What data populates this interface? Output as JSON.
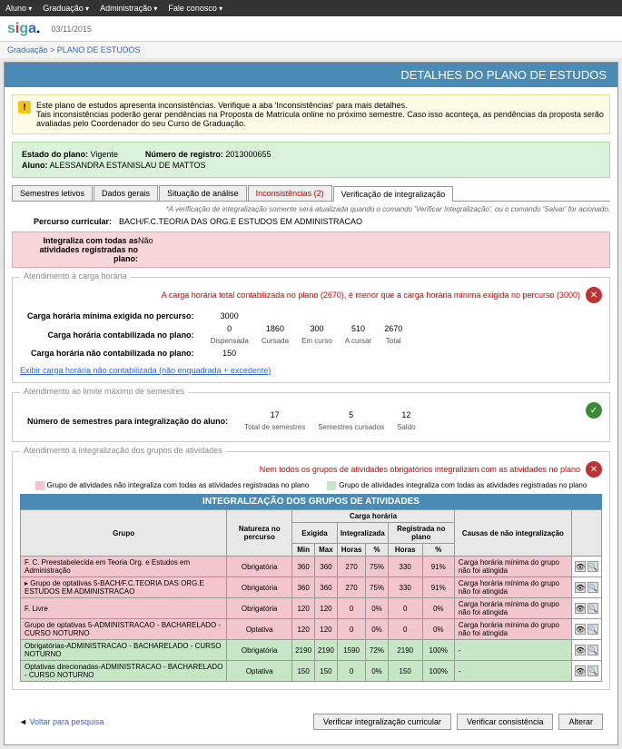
{
  "topbar": [
    "Aluno",
    "Graduação",
    "Administração",
    "Fale conosco"
  ],
  "date": "03/11/2015",
  "breadcrumb": {
    "root": "Graduação",
    "page": "PLANO DE ESTUDOS"
  },
  "title": "DETALHES DO PLANO DE ESTUDOS",
  "warning": {
    "line1": "Este plano de estudos apresenta inconsistências. Verifique a aba 'Inconsistências' para mais detalhes.",
    "line2": "Tais inconsistências poderão gerar pendências na Proposta de Matrícula online no próximo semestre. Caso isso aconteça, as pendências da proposta serão avaliadas pelo Coordenador do seu Curso de Graduação."
  },
  "info": {
    "estado_label": "Estado do plano:",
    "estado": "Vigente",
    "registro_label": "Número de registro:",
    "registro": "2013000655",
    "aluno_label": "Aluno:",
    "aluno": "ALESSANDRA ESTANISLAU DE MATTOS"
  },
  "tabs": {
    "t1": "Semestres letivos",
    "t2": "Dados gerais",
    "t3": "Situação de análise",
    "t4": "Inconsistências (2)",
    "t5": "Verificação de integralização"
  },
  "note": "*A verificação de integralização somente será atualizada quando o comando 'Verificar Integralização', ou o comando 'Salvar' for acionado.",
  "percurso_label": "Percurso curricular:",
  "percurso": "BACH/F.C.TEORIA DAS ORG.E ESTUDOS EM ADMINISTRACAO",
  "integraliza_label": "Integraliza com todas as atividades registradas no plano:",
  "integraliza": "Não",
  "fs1": {
    "legend": "Atendimento à carga horária",
    "err": "A carga horária total contabilizada no plano (2670), é menor que a carga horária mínima exigida no percurso (3000)",
    "r1_label": "Carga horária mínima exigida no percurso:",
    "r1_v": "3000",
    "r2_label": "Carga horária contabilizada no plano:",
    "r2_cols": [
      "0",
      "1860",
      "300",
      "510",
      "2670"
    ],
    "r2_sub": [
      "Dispensada",
      "Cursada",
      "Em curso",
      "A cursar",
      "Total"
    ],
    "r3_label": "Carga horária não contabilizada no plano:",
    "r3_v": "150",
    "link": "Exibir carga horária não contabilizada (não enquadrada + excedente)"
  },
  "fs2": {
    "legend": "Atendimento ao limite máximo de semestres",
    "r_label": "Número de semestres para integralização do aluno:",
    "vals": [
      "17",
      "5",
      "12"
    ],
    "subs": [
      "Total de semestres",
      "Semestres cursados",
      "Saldo"
    ]
  },
  "fs3": {
    "legend": "Atendimento à integralização dos grupos de atividades",
    "err": "Nem todos os grupos de atividades obrigatórios integralizam com as atividades no plano",
    "leg_pink": "Grupo de atividades não integraliza com todas as atividades registradas no plano",
    "leg_green": "Grupo de atividades integraliza com todas as atividades registradas no plano",
    "int_title": "INTEGRALIZAÇÃO DOS GRUPOS DE ATIVIDADES",
    "headers": {
      "grupo": "Grupo",
      "natureza": "Natureza no percurso",
      "ch": "Carga horária",
      "exigida": "Exigida",
      "integralizada": "Integralizada",
      "reg": "Registrada no plano",
      "min": "Min",
      "max": "Max",
      "horas": "Horas",
      "pct": "%",
      "causas": "Causas de não integralização"
    },
    "rows": [
      {
        "cls": "pink",
        "grupo": "F. C. Preestabelecida em Teoria Org. e Estudos em Administração",
        "natureza": "Obrigatória",
        "min": "360",
        "max": "360",
        "ih": "270",
        "ip": "75%",
        "rh": "330",
        "rp": "91%",
        "causa": "Carga horária mínima do grupo não foi atingida"
      },
      {
        "cls": "pink",
        "grupo": "Grupo de optativas 5-BACH/F.C.TEORIA DAS ORG.E ESTUDOS EM ADMINISTRACAO",
        "natureza": "Obrigatória",
        "min": "360",
        "max": "360",
        "ih": "270",
        "ip": "75%",
        "rh": "330",
        "rp": "91%",
        "causa": "Carga horária mínima do grupo não foi atingida",
        "icon": true
      },
      {
        "cls": "pink",
        "grupo": "F. Livre",
        "natureza": "Obrigatória",
        "min": "120",
        "max": "120",
        "ih": "0",
        "ip": "0%",
        "rh": "0",
        "rp": "0%",
        "causa": "Carga horária mínima do grupo não foi atingida"
      },
      {
        "cls": "pink",
        "grupo": "Grupo de optativas 5-ADMINISTRACAO - BACHARELADO - CURSO NOTURNO",
        "natureza": "Optativa",
        "min": "120",
        "max": "120",
        "ih": "0",
        "ip": "0%",
        "rh": "0",
        "rp": "0%",
        "causa": "Carga horária mínima do grupo não foi atingida"
      },
      {
        "cls": "green",
        "grupo": "Obrigatórias-ADMINISTRACAO - BACHARELADO - CURSO NOTURNO",
        "natureza": "Obrigatória",
        "min": "2190",
        "max": "2190",
        "ih": "1590",
        "ip": "72%",
        "rh": "2190",
        "rp": "100%",
        "causa": "-"
      },
      {
        "cls": "green",
        "grupo": "Optativas direcionadas-ADMINISTRACAO - BACHARELADO - CURSO NOTURNO",
        "natureza": "Optativa",
        "min": "150",
        "max": "150",
        "ih": "0",
        "ip": "0%",
        "rh": "150",
        "rp": "100%",
        "causa": "-"
      }
    ]
  },
  "back": "Voltar para pesquisa",
  "buttons": {
    "b1": "Verificar integralização curricular",
    "b2": "Verificar consistência",
    "b3": "Alterar"
  }
}
